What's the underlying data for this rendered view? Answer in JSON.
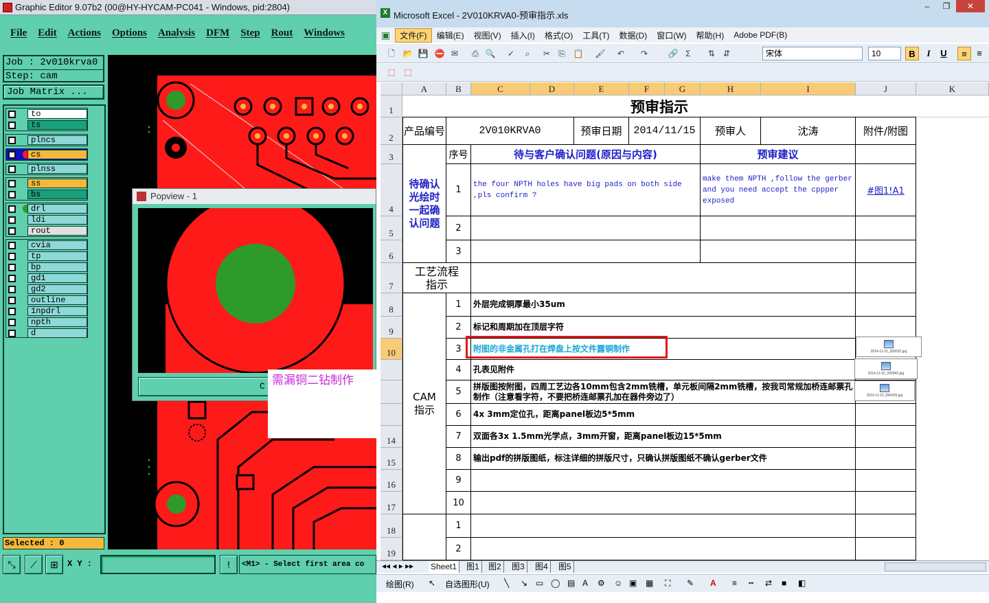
{
  "ge": {
    "title": "Graphic Editor 9.07b2 (00@HY-HYCAM-PC041 - Windows, pid:2804)",
    "menu": [
      "File",
      "Edit",
      "Actions",
      "Options",
      "Analysis",
      "DFM",
      "Step",
      "Rout",
      "Windows"
    ],
    "job_line": "Job : 2v010krva0",
    "step_line": "Step: cam",
    "job_matrix": "Job Matrix ...",
    "layers": [
      [
        "to",
        "ts"
      ],
      [
        "plncs"
      ],
      [
        "cs"
      ],
      [
        "plnss"
      ],
      [
        "ss",
        "bs"
      ],
      [
        "drl",
        "ldi",
        "rout"
      ],
      [
        "cvia",
        "tp",
        "bp",
        "gd1",
        "gd2",
        "outline",
        "1npdrl",
        "npth",
        "d"
      ]
    ],
    "selected": "Selected : 0",
    "xy_label": "X Y :",
    "message": "<M1> - Select first area co",
    "popview_title": "Popview - 1",
    "popview_button": "C",
    "note": "需漏铜二钻制作"
  },
  "xl": {
    "title": "Microsoft Excel - 2V010KRVA0-预审指示.xls",
    "window_buttons": [
      "–",
      "❐",
      "✕"
    ],
    "menu": [
      "文件(F)",
      "编辑(E)",
      "视图(V)",
      "插入(I)",
      "格式(O)",
      "工具(T)",
      "数据(D)",
      "窗口(W)",
      "帮助(H)",
      "Adobe PDF(B)"
    ],
    "font": "宋体",
    "size": "10",
    "columns": [
      "A",
      "B",
      "C",
      "D",
      "E",
      "F",
      "G",
      "H",
      "I",
      "J",
      "K"
    ],
    "rows": [
      "1",
      "2",
      "3",
      "4",
      "5",
      "6",
      "7",
      "8",
      "9",
      "10",
      "",
      "",
      "",
      "14",
      "15",
      "16",
      "17",
      "18",
      "19"
    ],
    "sheet_title": "预审指示",
    "r2": {
      "a": "产品编号",
      "c": "2V010KRVA0",
      "e": "预审日期",
      "f": "2014/11/15",
      "h": "预审人",
      "i": "沈涛",
      "j": "附件/附图"
    },
    "r3": {
      "b": "序号",
      "c": "待与客户确认问题(原因与内容)",
      "h": "预审建议"
    },
    "confirm_label": "待确认光绘时一起确认问题",
    "q1_num": "1",
    "q1": "the four NPTH holes have big pads on both side ,pls confirm ?",
    "q1_suggest": "make them NPTH ,follow the gerber and you need accept the cppper exposed",
    "q1_link": "#图1!A1",
    "q2_num": "2",
    "q3_num": "3",
    "process_label": "工艺流程指示",
    "cam_label": "CAM指示",
    "cam_items": [
      {
        "n": "1",
        "t": "外层完成铜厚最小35um"
      },
      {
        "n": "2",
        "t": "标记和周期加在顶层字符"
      },
      {
        "n": "3",
        "t": "附图的非金属孔打在焊盘上按文件露铜制作"
      },
      {
        "n": "4",
        "t": "孔表见附件"
      },
      {
        "n": "5",
        "t": "拼版图按附图，四周工艺边各10mm包含2mm铣槽，单元板间隔2mm铣槽，按我司常规加桥连邮票孔制作（注意看字符，不要把桥连邮票孔加在器件旁边了）"
      },
      {
        "n": "6",
        "t": "4x 3mm定位孔，距离panel板边5*5mm"
      },
      {
        "n": "7",
        "t": "双面各3x 1.5mm光学点，3mm开窗，距离panel板边15*5mm"
      },
      {
        "n": "8",
        "t": "输出pdf的拼版图纸，标注详细的拼版尺寸，只确认拼版图纸不确认gerber文件"
      },
      {
        "n": "9",
        "t": ""
      },
      {
        "n": "10",
        "t": ""
      },
      {
        "n": "1",
        "t": ""
      },
      {
        "n": "2",
        "t": ""
      }
    ],
    "attachments": [
      "2014-11-15_093032.jpg",
      "2014-11-15_092842.jpg",
      "2014-11-15_094209.jpg"
    ],
    "tabs": [
      "Sheet1",
      "图1",
      "图2",
      "图3",
      "图4",
      "图5"
    ],
    "draw_label": "绘图(R)",
    "autoshape_label": "自选图形(U)"
  },
  "colors": {
    "ge_bg": "#5fcfad",
    "pcb_red": "#ff1a1a",
    "pad_green": "#2e9a2a",
    "highlight": "#e01919"
  }
}
